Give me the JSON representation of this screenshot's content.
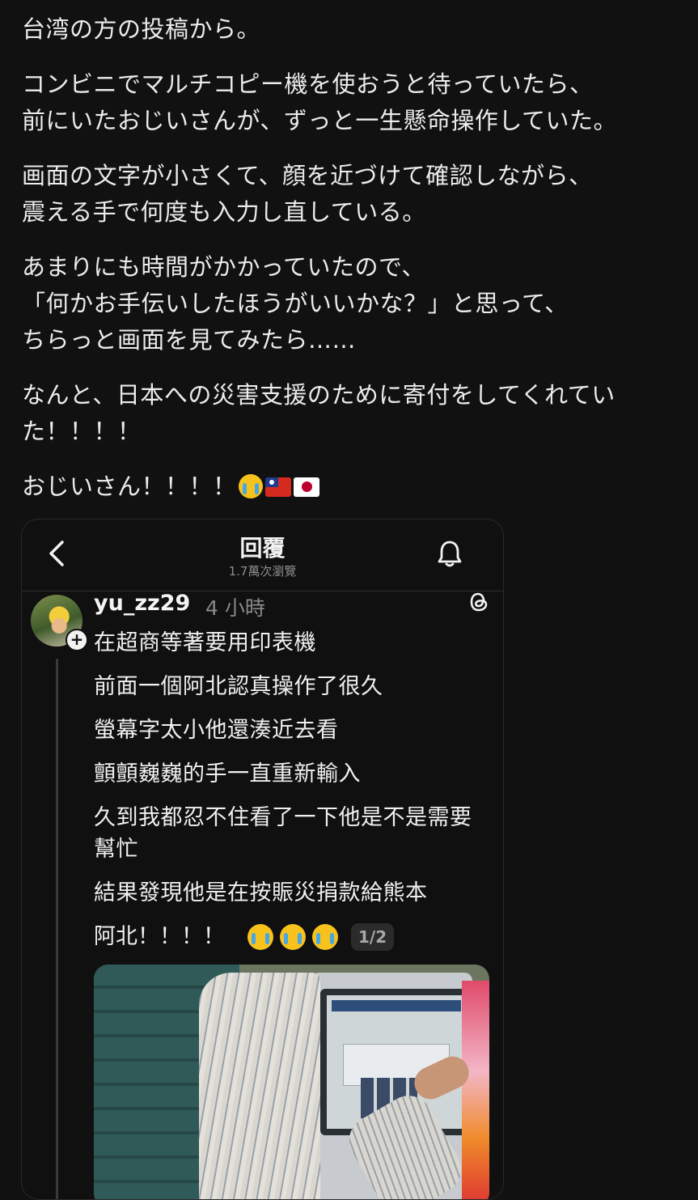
{
  "post": {
    "paragraphs": [
      [
        "台湾の方の投稿から。"
      ],
      [
        "コンビニでマルチコピー機を使おうと待っていたら、",
        "前にいたおじいさんが、ずっと一生懸命操作していた。"
      ],
      [
        "画面の文字が小さくて、顔を近づけて確認しながら、",
        "震える手で何度も入力し直している。"
      ],
      [
        "あまりにも時間がかかっていたので、",
        "「何かお手伝いしたほうがいいかな？」と思って、",
        "ちらっと画面を見てみたら……"
      ],
      [
        "なんと、日本への災害支援のために寄付をしてくれてい",
        "た！！！！"
      ]
    ],
    "last_line": "おじいさん！！！！",
    "last_line_emojis": [
      "crying-face",
      "taiwan-flag",
      "japan-flag"
    ]
  },
  "card": {
    "title": "回覆",
    "subtitle": "1.7萬次瀏覽",
    "username": "yu_zz29",
    "time": "4 小時",
    "reply_lines": [
      "在超商等著要用印表機",
      "前面一個阿北認真操作了很久",
      "螢幕字太小他還湊近去看",
      "顫顫巍巍的手一直重新輸入",
      "久到我都忍不住看了一下他是不是需要幫忙",
      "結果發現他是在按賑災捐款給熊本"
    ],
    "reply_last": "阿北！！！！",
    "reply_last_emojis": [
      "crying-face",
      "crying-face",
      "crying-face"
    ],
    "page_indicator": "1/2",
    "icons": {
      "back": "chevron-left-icon",
      "bell": "bell-icon",
      "threads": "threads-logo-icon",
      "follow": "plus-icon"
    },
    "photo_alt": "Elderly man operating a convenience store kiosk touchscreen"
  }
}
